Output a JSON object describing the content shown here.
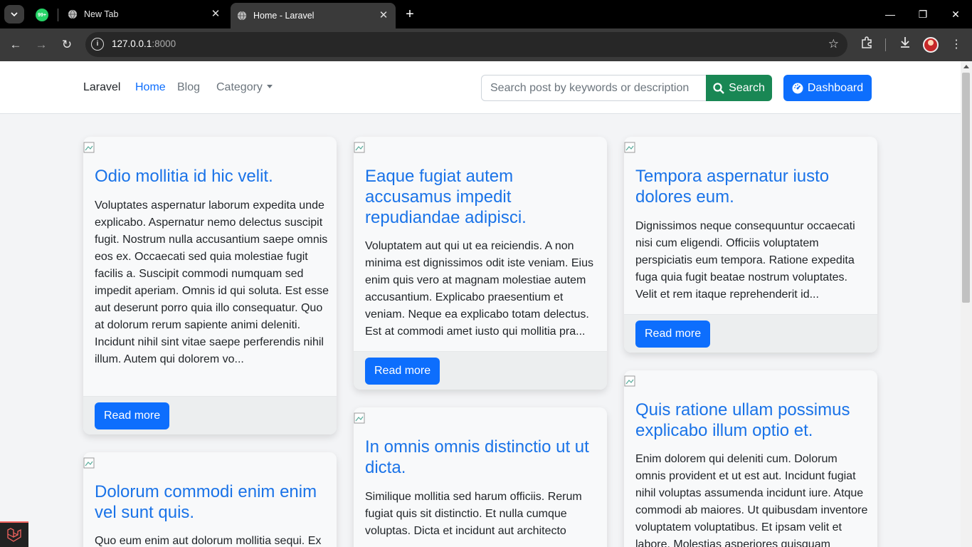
{
  "browser": {
    "tabs": [
      {
        "title": "New Tab",
        "active": false
      },
      {
        "title": "Home - Laravel",
        "active": true
      }
    ],
    "pinned_badge": "99+",
    "url_host": "127.0.0.1",
    "url_port": ":8000"
  },
  "navbar": {
    "brand": "Laravel",
    "links": {
      "home": "Home",
      "blog": "Blog",
      "category": "Category"
    },
    "search_placeholder": "Search post by keywords or description",
    "search_label": "Search",
    "dashboard_label": "Dashboard"
  },
  "posts": [
    {
      "title": "Odio mollitia id hic velit.",
      "excerpt": "Voluptates aspernatur laborum expedita unde explicabo. Aspernatur nemo delectus suscipit fugit. Nostrum nulla accusantium saepe omnis eos ex. Occaecati sed quia molestiae fugit facilis a. Suscipit commodi numquam sed impedit aperiam. Omnis id qui soluta. Est esse aut deserunt porro quia illo consequatur. Quo at dolorum rerum sapiente animi deleniti. Incidunt nihil sint vitae saepe perferendis nihil illum. Autem qui dolorem vo...",
      "read_more": "Read more"
    },
    {
      "title": "Eaque fugiat autem accusamus impedit repudiandae adipisci.",
      "excerpt": "Voluptatem aut qui ut ea reiciendis. A non minima est dignissimos odit iste veniam. Eius enim quis vero at magnam molestiae autem accusantium. Explicabo praesentium et veniam. Neque ea explicabo totam delectus. Est at commodi amet iusto qui mollitia pra...",
      "read_more": "Read more"
    },
    {
      "title": "Tempora aspernatur iusto dolores eum.",
      "excerpt": "Dignissimos neque consequuntur occaecati nisi cum eligendi. Officiis voluptatem perspiciatis eum tempora. Ratione expedita fuga quia fugit beatae nostrum voluptates. Velit et rem itaque reprehenderit id...",
      "read_more": "Read more"
    },
    {
      "title": "Dolorum commodi enim enim vel sunt quis.",
      "excerpt": "Quo eum enim aut dolorum mollitia sequi. Ex"
    },
    {
      "title": "In omnis omnis distinctio ut ut dicta.",
      "excerpt": "Similique mollitia sed harum officiis. Rerum fugiat quis sit distinctio. Et nulla cumque voluptas. Dicta et incidunt aut architecto"
    },
    {
      "title": "Quis ratione ullam possimus explicabo illum optio et.",
      "excerpt": "Enim dolorem qui deleniti cum. Dolorum omnis provident et ut est aut. Incidunt fugiat nihil voluptas assumenda incidunt iure. Atque commodi ab maiores. Ut quibusdam inventore voluptatem voluptatibus. Et ipsam velit et labore. Molestias asperiores quisquam"
    }
  ]
}
